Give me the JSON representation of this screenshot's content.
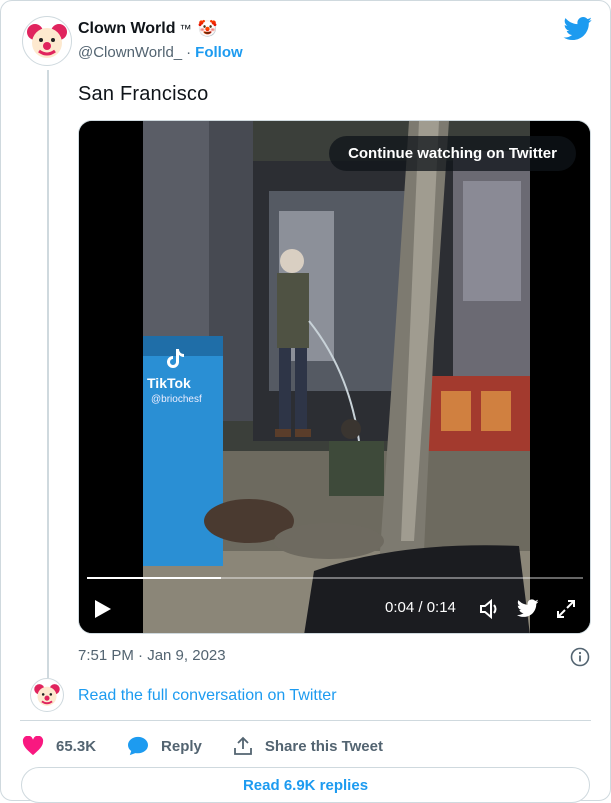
{
  "author": {
    "name": "Clown World",
    "name_suffix": "™",
    "emoji": "🤡",
    "handle": "@ClownWorld_",
    "separator": "·",
    "follow_label": "Follow"
  },
  "tweet": {
    "text": "San Francisco"
  },
  "media": {
    "continue_label": "Continue watching on Twitter",
    "watermark_brand": "TikTok",
    "watermark_user": "@briochesf",
    "time_display": "0:04 / 0:14",
    "progress_fraction": 0.27,
    "controls": [
      "play-icon",
      "volume-icon",
      "twitter-bird-icon",
      "fullscreen-icon"
    ]
  },
  "meta": {
    "timestamp": "7:51 PM · Jan 9, 2023",
    "info_icon": "info-icon"
  },
  "conversation": {
    "read_label": "Read the full conversation on Twitter"
  },
  "actions": {
    "like_count": "65.3K",
    "reply_label": "Reply",
    "share_label": "Share this Tweet"
  },
  "replies": {
    "button_label": "Read 6.9K replies"
  },
  "colors": {
    "accent": "#1d9bf0",
    "like": "#f91880",
    "muted": "#536471",
    "border": "#cfd9de"
  }
}
